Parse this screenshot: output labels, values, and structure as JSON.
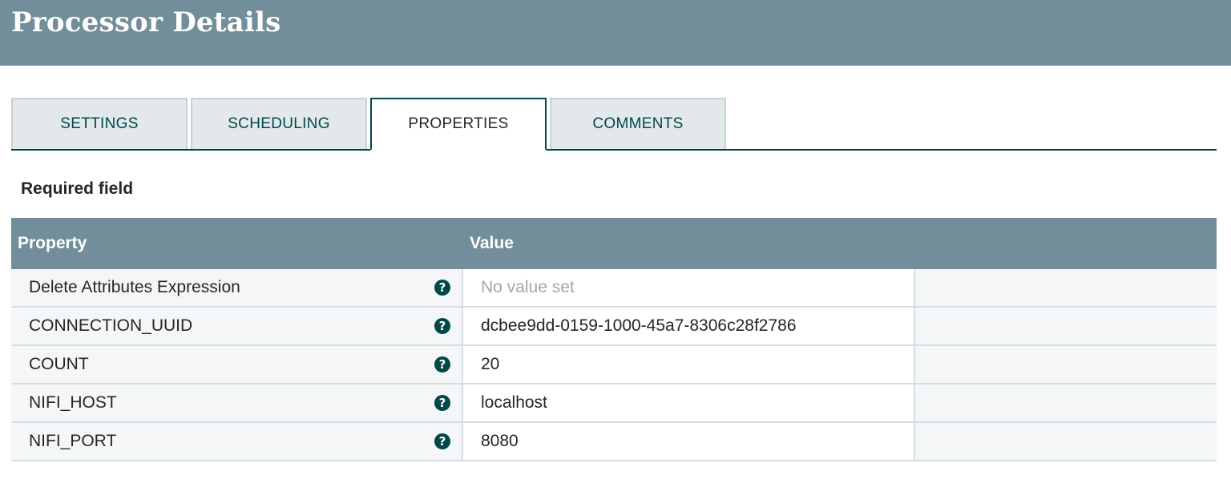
{
  "header": {
    "title": "Processor Details"
  },
  "tabs": [
    {
      "label": "SETTINGS",
      "active": false
    },
    {
      "label": "SCHEDULING",
      "active": false
    },
    {
      "label": "PROPERTIES",
      "active": true
    },
    {
      "label": "COMMENTS",
      "active": false
    }
  ],
  "required_label": "Required field",
  "table": {
    "columns": {
      "property": "Property",
      "value": "Value"
    },
    "rows": [
      {
        "name": "Delete Attributes Expression",
        "value": "No value set",
        "is_placeholder": true
      },
      {
        "name": "CONNECTION_UUID",
        "value": "dcbee9dd-0159-1000-45a7-8306c28f2786",
        "is_placeholder": false
      },
      {
        "name": "COUNT",
        "value": "20",
        "is_placeholder": false
      },
      {
        "name": "NIFI_HOST",
        "value": "localhost",
        "is_placeholder": false
      },
      {
        "name": "NIFI_PORT",
        "value": "8080",
        "is_placeholder": false
      }
    ]
  },
  "icons": {
    "help": "help-circle-icon"
  },
  "colors": {
    "header_bg": "#728e9b",
    "accent": "#004849",
    "tab_bg": "#e3e8eb",
    "placeholder_text": "#a6a6a6"
  }
}
